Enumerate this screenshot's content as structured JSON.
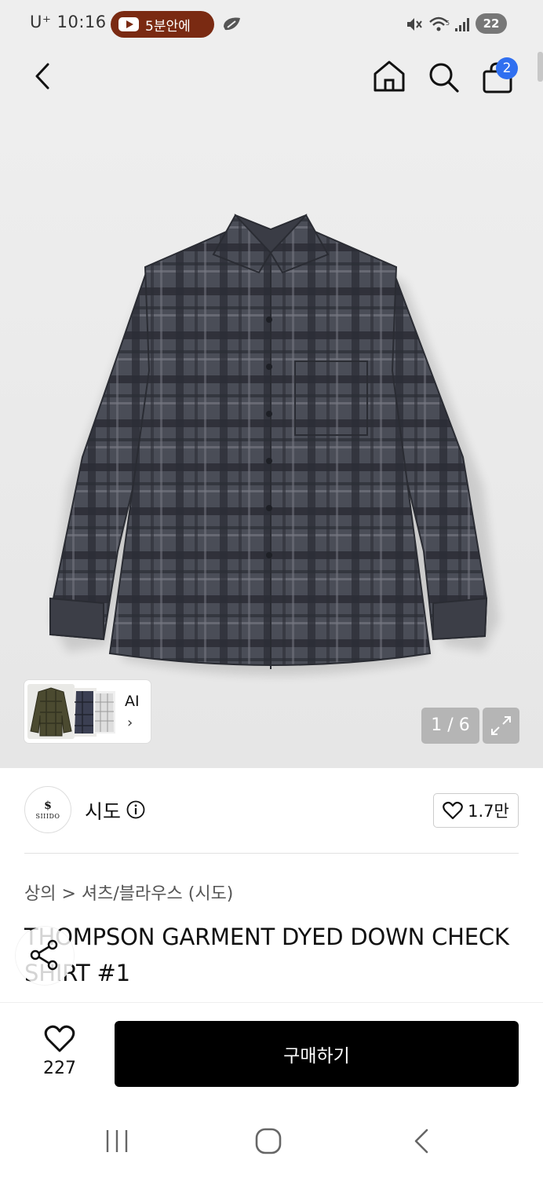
{
  "status_bar": {
    "carrier": "U⁺ 10:16",
    "pill_text": "5분안에",
    "battery": "22"
  },
  "header": {
    "cart_badge": "2",
    "icons": [
      "back-icon",
      "home-icon",
      "search-icon",
      "cart-icon"
    ]
  },
  "gallery": {
    "counter": "1 / 6",
    "ai_label": "AI",
    "ai_chevron": "›",
    "colors": {
      "shirt_base": "#4a4d57",
      "shirt_dark": "#2b2d35",
      "bg": "#eeeeee"
    }
  },
  "brand": {
    "logo_mark": "$",
    "logo_word": "SIIIDO",
    "name": "시도",
    "likes": "1.7만"
  },
  "product": {
    "breadcrumb": "상의 > 셔츠/블라우스 (시도)",
    "title": "THOMPSON GARMENT DYED DOWN CHECK SHIRT #1"
  },
  "bottom": {
    "wish_count": "227",
    "buy_label": "구매하기",
    "buy_color": "#000000"
  },
  "nav": {
    "icons": [
      "recents-icon",
      "home-nav-icon",
      "back-nav-icon"
    ]
  }
}
